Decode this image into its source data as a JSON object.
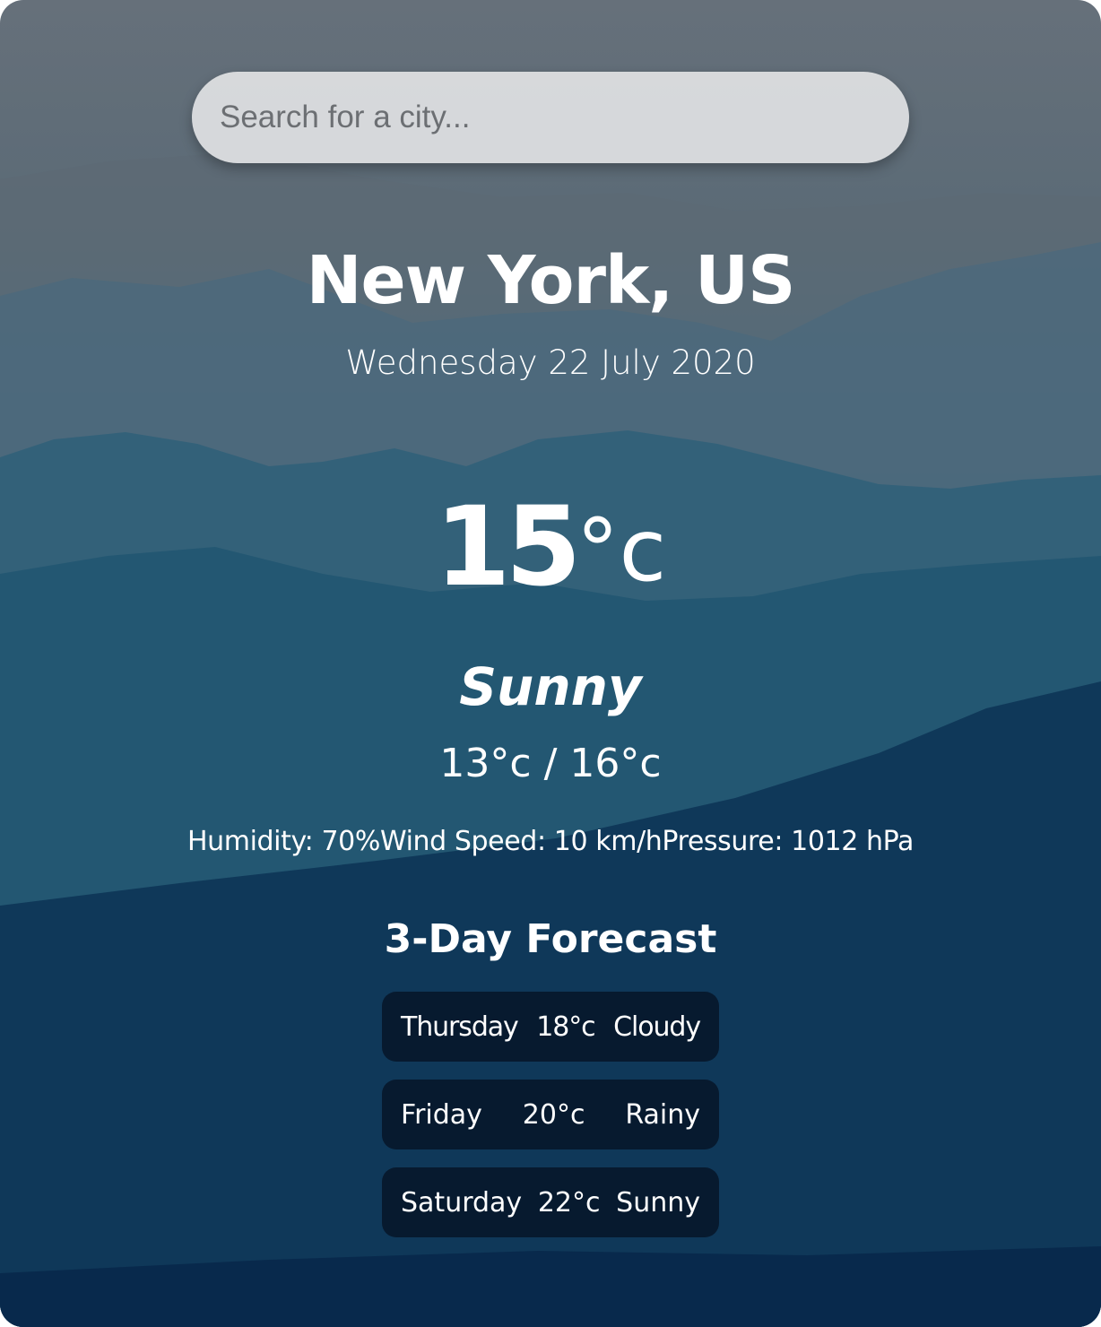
{
  "search": {
    "placeholder": "Search for a city..."
  },
  "location": {
    "city": "New York, US",
    "date": "Wednesday 22 July 2020"
  },
  "current": {
    "temperature": "15",
    "unit": "°c",
    "condition": "Sunny",
    "low_high": "13°c / 16°c",
    "humidity": "Humidity: 70%",
    "wind_speed": "Wind Speed: 10 km/h",
    "pressure": "Pressure: 1012 hPa"
  },
  "forecast": {
    "title": "3-Day Forecast",
    "days": [
      {
        "day": "Thursday",
        "temp": "18°c",
        "condition": "Cloudy"
      },
      {
        "day": "Friday",
        "temp": "20°c",
        "condition": "Rainy"
      },
      {
        "day": "Saturday",
        "temp": "22°c",
        "condition": "Sunny"
      }
    ]
  },
  "colors": {
    "text": "#ffffff",
    "search_bg": "#e1e2e4",
    "forecast_card_bg": "#05122494"
  }
}
